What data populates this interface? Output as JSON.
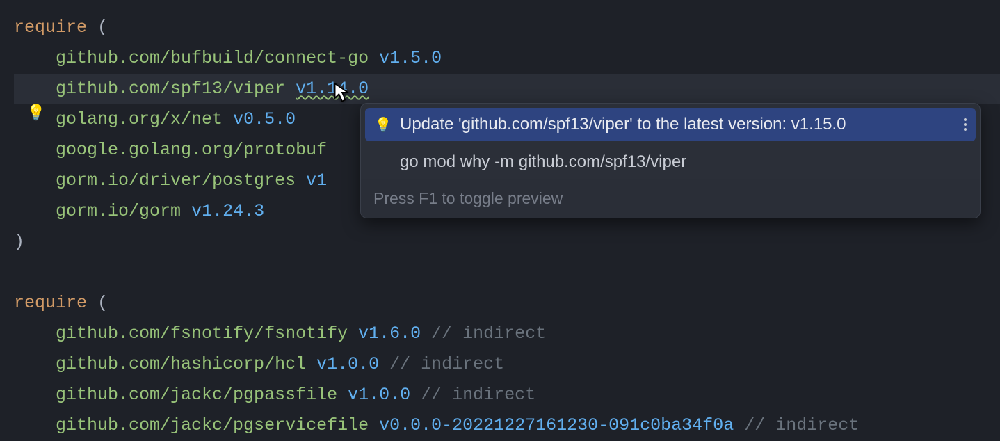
{
  "code": {
    "require1_kw": "require",
    "open_paren": " (",
    "close_paren": ")",
    "deps1": {
      "l0p": "github.com/bufbuild/connect-go",
      "l0v": "v1.5.0",
      "l1p": "github.com/spf13/viper",
      "l1v": "v1.14.0",
      "l2p": "golang.org/x/net",
      "l2v": "v0.5.0",
      "l3p": "google.golang.org/protobuf",
      "l4p": "gorm.io/driver/postgres",
      "l4v": "v1",
      "l5p": "gorm.io/gorm",
      "l5v": "v1.24.3"
    },
    "require2_kw": "require",
    "deps2": {
      "l0p": "github.com/fsnotify/fsnotify",
      "l0v": "v1.6.0",
      "l0c": "// indirect",
      "l1p": "github.com/hashicorp/hcl",
      "l1v": "v1.0.0",
      "l1c": "// indirect",
      "l2p": "github.com/jackc/pgpassfile",
      "l2v": "v1.0.0",
      "l2c": "// indirect",
      "l3p": "github.com/jackc/pgservicefile",
      "l3v": "v0.0.0-20221227161230-091c0ba34f0a",
      "l3c": "// indirect"
    }
  },
  "gutter": {
    "bulb_icon": "💡"
  },
  "popup": {
    "action1": "Update 'github.com/spf13/viper' to the latest version: v1.15.0",
    "action1_icon": "💡",
    "action2": "go mod why -m github.com/spf13/viper",
    "footer": "Press F1 to toggle preview"
  }
}
